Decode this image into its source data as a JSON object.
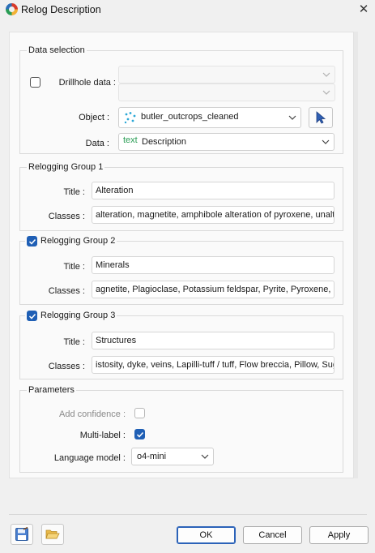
{
  "window": {
    "title": "Relog Description"
  },
  "data_selection": {
    "legend": "Data selection",
    "drillhole_label": "Drillhole data :",
    "drillhole_checked": false,
    "object_label": "Object :",
    "object_value": "butler_outcrops_cleaned",
    "data_label": "Data :",
    "data_type_tag": "text",
    "data_value": "Description"
  },
  "groups": [
    {
      "legend": "Relogging Group 1",
      "has_checkbox": false,
      "checked": false,
      "title_label": "Title :",
      "title_value": "Alteration",
      "classes_label": "Classes :",
      "classes_value": "alteration, magnetite, amphibole alteration of pyroxene, unaltered"
    },
    {
      "legend": "Relogging Group 2",
      "has_checkbox": true,
      "checked": true,
      "title_label": "Title :",
      "title_value": "Minerals",
      "classes_label": "Classes :",
      "classes_value": "agnetite, Plagioclase, Potassium feldspar, Pyrite, Pyroxene, Quartz"
    },
    {
      "legend": "Relogging Group 3",
      "has_checkbox": true,
      "checked": true,
      "title_label": "Title :",
      "title_value": "Structures",
      "classes_label": "Classes :",
      "classes_value": "istosity, dyke, veins, Lapilli-tuff / tuff, Flow breccia, Pillow, Sugary"
    }
  ],
  "parameters": {
    "legend": "Parameters",
    "confidence_label": "Add confidence :",
    "confidence_checked": false,
    "multilabel_label": "Multi-label :",
    "multilabel_checked": true,
    "model_label": "Language model :",
    "model_value": "o4-mini"
  },
  "footer": {
    "ok": "OK",
    "cancel": "Cancel",
    "apply": "Apply"
  },
  "icons": {
    "close": "close-icon",
    "save": "save-icon",
    "folder": "folder-open-icon",
    "pick": "cursor-pick-icon",
    "points": "points-object-icon"
  }
}
